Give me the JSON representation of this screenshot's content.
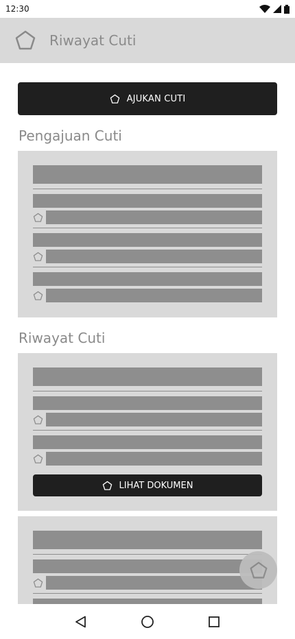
{
  "status_bar": {
    "time": "12:30"
  },
  "app_bar": {
    "title": "Riwayat Cuti",
    "logo_icon": "pentagon-icon"
  },
  "actions": {
    "apply_leave_label": "AJUKAN CUTI"
  },
  "sections": {
    "submissions_title": "Pengajuan Cuti",
    "history_title": "Riwayat Cuti"
  },
  "history_card": {
    "view_document_label": "LIHAT DOKUMEN"
  },
  "colors": {
    "app_bar_bg": "#d9d9d9",
    "card_bg": "#d9d9d9",
    "placeholder": "#8e8e8e",
    "button_dark": "#1f1f1f",
    "title_gray": "#8a8a8a"
  },
  "icons": {
    "fab": "pentagon-icon",
    "nav_back": "back-triangle-icon",
    "nav_home": "home-circle-icon",
    "nav_recents": "recents-square-icon"
  }
}
